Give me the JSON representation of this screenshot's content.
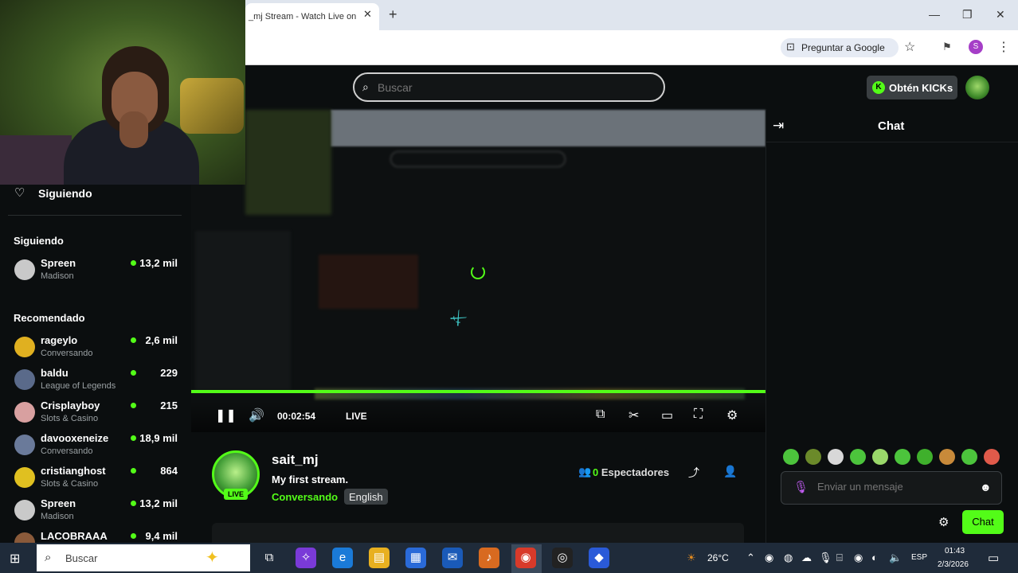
{
  "browser": {
    "tab_title": "_mj Stream - Watch Live on",
    "tab_close": "✕",
    "new_tab": "+",
    "ask_google": "Preguntar a Google",
    "profile_initial": "S",
    "window_minimize": "—",
    "window_restore": "❐",
    "window_close": "✕"
  },
  "header": {
    "search_placeholder": "Buscar",
    "kicks_button": "Obtén KICKs",
    "kicks_icon_letter": "K"
  },
  "sidebar": {
    "following_nav": "Siguiendo",
    "following_title": "Siguiendo",
    "recommended_title": "Recomendado",
    "following": [
      {
        "name": "Spreen",
        "category": "Madison",
        "viewers": "13,2 mil"
      }
    ],
    "recommended": [
      {
        "name": "rageylo",
        "category": "Conversando",
        "viewers": "2,6 mil"
      },
      {
        "name": "baldu",
        "category": "League of Legends",
        "viewers": "229"
      },
      {
        "name": "Crisplayboy",
        "category": "Slots & Casino",
        "viewers": "215"
      },
      {
        "name": "davooxeneize",
        "category": "Conversando",
        "viewers": "18,9 mil"
      },
      {
        "name": "cristianghost",
        "category": "Slots & Casino",
        "viewers": "864"
      },
      {
        "name": "Spreen",
        "category": "Madison",
        "viewers": "13,2 mil"
      },
      {
        "name": "LACOBRAAA",
        "category": "",
        "viewers": "9,4 mil"
      }
    ]
  },
  "player": {
    "elapsed": "00:02:54",
    "live_label": "LIVE",
    "progress": 1.0
  },
  "stream": {
    "streamer": "sait_mj",
    "live_badge": "LIVE",
    "title": "My first stream.",
    "category": "Conversando",
    "tag": "English",
    "viewer_count": "0",
    "viewer_label": "Espectadores"
  },
  "chat": {
    "title": "Chat",
    "message_placeholder": "Enviar un mensaje",
    "send_label": "Chat"
  },
  "taskbar": {
    "search_text": "Buscar",
    "temperature": "26°C",
    "language": "ESP",
    "time": "01:43",
    "date": "2/3/2026"
  },
  "colors": {
    "kick_green": "#53fc18",
    "background": "#0b0e0f",
    "taskbar": "#1f2b3a"
  }
}
